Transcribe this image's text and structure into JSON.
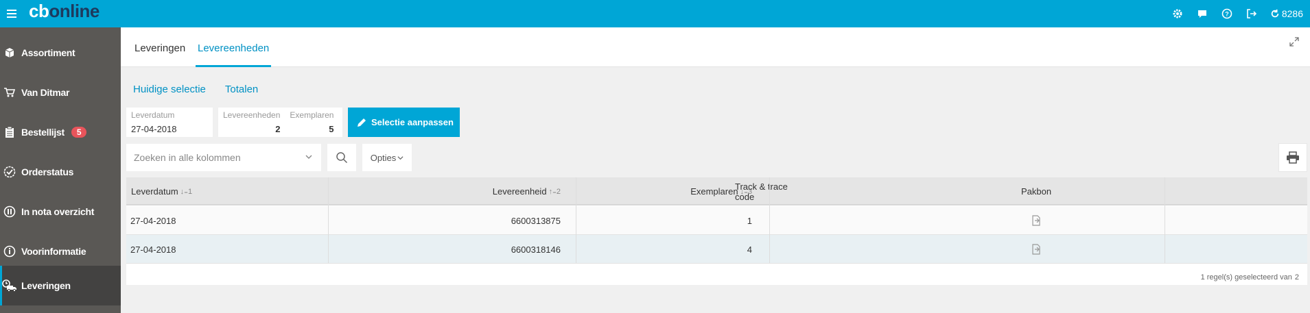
{
  "app": {
    "logo_cb": "cb",
    "logo_online": "online",
    "top_count": "8286"
  },
  "sidebar": {
    "items": [
      {
        "label": "Assortiment",
        "icon": "box-icon"
      },
      {
        "label": "Van Ditmar",
        "icon": "cart-icon"
      },
      {
        "label": "Bestellijst",
        "icon": "clipboard-icon",
        "badge": "5"
      },
      {
        "label": "Orderstatus",
        "icon": "check-circle-icon"
      },
      {
        "label": "In nota overzicht",
        "icon": "pause-circle-icon"
      },
      {
        "label": "Voorinformatie",
        "icon": "info-circle-icon"
      },
      {
        "label": "Leveringen",
        "icon": "truck-icon",
        "active": true
      }
    ]
  },
  "tabs": [
    {
      "label": "Leveringen"
    },
    {
      "label": "Levereenheden",
      "active": true
    }
  ],
  "sublinks": {
    "current": "Huidige selectie",
    "totals": "Totalen"
  },
  "selection": {
    "leverdatum_label": "Leverdatum",
    "leverdatum_value": "27-04-2018",
    "levereenheden_label": "Levereenheden",
    "levereenheden_value": "2",
    "exemplaren_label": "Exemplaren",
    "exemplaren_value": "5",
    "button_label": "Selectie aanpassen"
  },
  "search": {
    "placeholder": "Zoeken in alle kolommen",
    "opties_label": "Opties"
  },
  "table": {
    "columns": {
      "leverdatum": "Leverdatum",
      "leverdatum_sort": "↓₌1",
      "levereenheid": "Levereenheid",
      "levereenheid_sort": "↑₌2",
      "exemplaren": "Exemplaren",
      "exemplaren_sort": "↓₌3",
      "track": "Track & trace code",
      "pakbon": "Pakbon"
    },
    "rows": [
      {
        "leverdatum": "27-04-2018",
        "levereenheid": "6600313875",
        "exemplaren": "1",
        "track": ""
      },
      {
        "leverdatum": "27-04-2018",
        "levereenheid": "6600318146",
        "exemplaren": "4",
        "track": ""
      }
    ],
    "footer_text": "1 regel(s) geselecteerd van",
    "footer_total": "2"
  },
  "colors": {
    "accent": "#00a6d6",
    "sidebar": "#5a5855",
    "badge": "#e8545b",
    "logo_dark": "#1d3a5e"
  }
}
